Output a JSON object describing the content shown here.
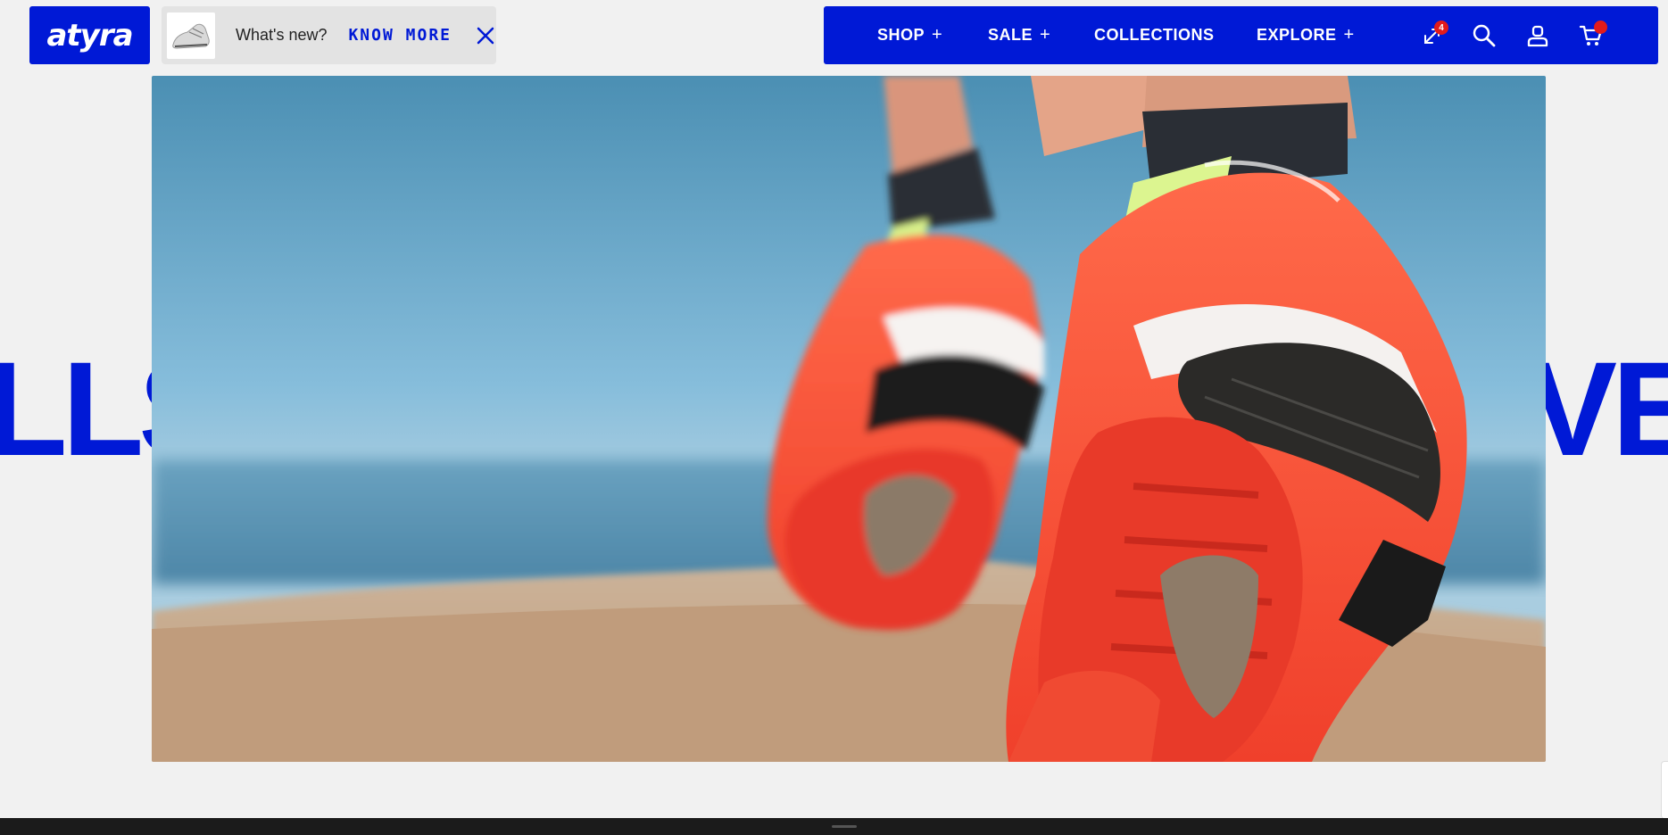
{
  "brand": {
    "logo_text": "atyra",
    "accent_color": "#0019d6"
  },
  "promo": {
    "thumbnail_icon": "sneaker-thumbnail",
    "text": "What's new?",
    "link_label": "KNOW MORE",
    "close_icon": "close-icon"
  },
  "nav": {
    "items": [
      {
        "label": "SHOP",
        "suffix": "+"
      },
      {
        "label": "SALE",
        "suffix": "+"
      },
      {
        "label": "COLLECTIONS",
        "suffix": ""
      },
      {
        "label": "EXPLORE",
        "suffix": "+"
      }
    ],
    "icons": {
      "compare": {
        "name": "compare-icon",
        "badge": "4"
      },
      "search": {
        "name": "search-icon"
      },
      "account": {
        "name": "account-icon"
      },
      "cart": {
        "name": "cart-icon",
        "dot_color": "#e21b1b"
      }
    }
  },
  "hero": {
    "marquee_left": "LLS",
    "marquee_right": "VE",
    "image": "running-shoes-close-up"
  }
}
